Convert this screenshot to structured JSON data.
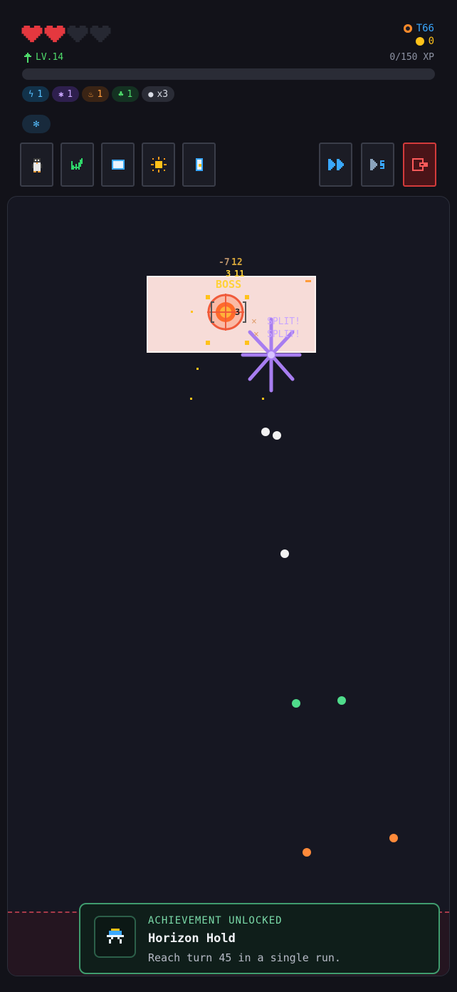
{
  "hud": {
    "hearts": {
      "total": 4,
      "filled": 2,
      "color": "#e4383f"
    },
    "turn": "T66",
    "gold": "0",
    "level": "LV.14",
    "xp_text": "0/150 XP",
    "xp_progress": 0
  },
  "chips": [
    {
      "icon": "blue-bolt-icon",
      "value": "1",
      "color": "#55bfff"
    },
    {
      "icon": "purple-star-icon",
      "value": "1",
      "color": "#c9a6ff"
    },
    {
      "icon": "orange-flame-icon",
      "value": "1",
      "color": "#ff9c3a"
    },
    {
      "icon": "green-leaf-icon",
      "value": "1",
      "color": "#4fdc6b"
    },
    {
      "icon": "white-ball-icon",
      "value": "x3",
      "color": "#d8dbe4"
    }
  ],
  "tools": [
    "penguin-icon",
    "chart-icon",
    "card-icon",
    "sun-icon",
    "door-icon"
  ],
  "controls": [
    "fast-forward-icon",
    "step-icon",
    "exit-icon"
  ],
  "arena": {
    "damage_values": [
      "-7",
      "12",
      "3",
      "11"
    ],
    "boss_label": "BOSS",
    "boss_hp_text": "3",
    "split_labels": [
      "SPLIT!",
      "SPLIT!"
    ],
    "split_x": "×",
    "balls": [
      {
        "color": "#f2f2f2"
      },
      {
        "color": "#f2f2f2"
      },
      {
        "color": "#f2f2f2"
      },
      {
        "color": "#4fdc8b"
      },
      {
        "color": "#4fdc8b"
      },
      {
        "color": "#ff8a3a"
      },
      {
        "color": "#ff8a3a"
      }
    ]
  },
  "toast": {
    "heading": "ACHIEVEMENT UNLOCKED",
    "title": "Horizon Hold",
    "description": "Reach turn 45 in a single run."
  }
}
